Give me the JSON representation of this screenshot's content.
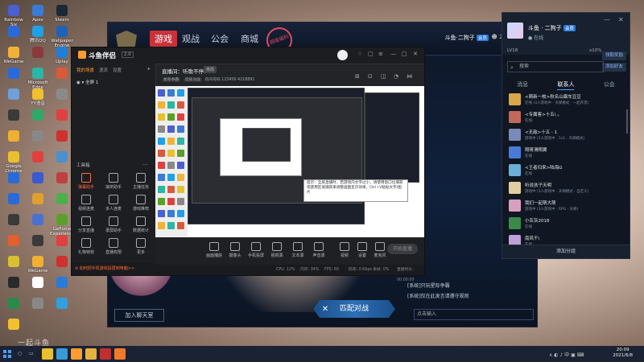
{
  "desktop_icons": [
    {
      "label": "Rainbow Six",
      "color": "#4a5fd0"
    },
    {
      "label": "Apex",
      "color": "#3a7bd5"
    },
    {
      "label": "Steam",
      "color": "#1b2838"
    },
    {
      "label": "",
      "color": "#2a6ad8"
    },
    {
      "label": "腾讯QQ",
      "color": "#1fa0e8"
    },
    {
      "label": "Wallpaper Engine",
      "color": "#1e62b8"
    },
    {
      "label": "WeGame",
      "color": "#f2b23a"
    },
    {
      "label": "",
      "color": "#8a3a3a"
    },
    {
      "label": "Uplay",
      "color": "#1e7fd8"
    },
    {
      "label": "",
      "color": "#2a6ad8"
    },
    {
      "label": "Microsoft Edge",
      "color": "#2cb6a5"
    },
    {
      "label": "",
      "color": "#d85a3a"
    },
    {
      "label": "",
      "color": "#6fa0d8"
    },
    {
      "label": "YY语音",
      "color": "#f0c030"
    },
    {
      "label": "",
      "color": "#8a8a8a"
    },
    {
      "label": "",
      "color": "#3a3a3a"
    },
    {
      "label": "",
      "color": "#2fa86a"
    },
    {
      "label": "",
      "color": "#e04040"
    },
    {
      "label": "",
      "color": "#f0b030"
    },
    {
      "label": "",
      "color": "#888888"
    },
    {
      "label": "",
      "color": "#d03030"
    },
    {
      "label": "Google Chrome",
      "color": "#e8c030"
    },
    {
      "label": "",
      "color": "#e04040"
    },
    {
      "label": "",
      "color": "#4a90d0"
    },
    {
      "label": "",
      "color": "#2a6ad8"
    },
    {
      "label": "",
      "color": "#3a5ad0"
    },
    {
      "label": "",
      "color": "#c04040"
    },
    {
      "label": "",
      "color": "#2a6ad8"
    },
    {
      "label": "",
      "color": "#e0a030"
    },
    {
      "label": "",
      "color": "#4ab04a"
    },
    {
      "label": "",
      "color": "#3a3a3a"
    },
    {
      "label": "",
      "color": "#4a70d0"
    },
    {
      "label": "GeForce Experience",
      "color": "#5aa02a"
    },
    {
      "label": "",
      "color": "#e06030"
    },
    {
      "label": "",
      "color": "#3a3a3a"
    },
    {
      "label": "",
      "color": "#e04040"
    },
    {
      "label": "",
      "color": "#d8c030"
    },
    {
      "label": "WeGame",
      "color": "#f0b030"
    },
    {
      "label": "",
      "color": "#d03030"
    },
    {
      "label": "",
      "color": "#2a2a2a"
    },
    {
      "label": "",
      "color": "#ffffff"
    },
    {
      "label": "",
      "color": "#2a7ad8"
    },
    {
      "label": "",
      "color": "#2a8a4a"
    },
    {
      "label": "",
      "color": "#888888"
    },
    {
      "label": "",
      "color": "#2fa0e0"
    },
    {
      "label": "",
      "color": "#f0c030"
    }
  ],
  "game": {
    "nav": [
      "游戏",
      "观战",
      "公会",
      "商城"
    ],
    "stamp": "超级福利",
    "username": "斗鱼·二狗子",
    "vip": "会员",
    "count": "24",
    "add_friend": "加入聊天室",
    "match_button": "匹配对战",
    "cancel_icon": "✕",
    "chat": [
      "[系统]只玩星际争霸",
      "[系统]仅在此发言请遵守规则"
    ],
    "input_placeholder": "点击输入"
  },
  "friends": {
    "name": "斗鱼 · 二狗子",
    "vip": "会员",
    "status": "在线",
    "level": "LV18",
    "level_pct": "x10%",
    "side_btn1": "领取奖励",
    "side_btn2": "添加好友",
    "search_placeholder": "搜索",
    "tabs": [
      "消息",
      "联系人",
      "公会"
    ],
    "active_tab": 1,
    "items": [
      {
        "name": "<萌新一枚>秋名山飙车豆豆",
        "status": "在线 (3人游戏中 · 天梯模式 · 一起开黑)",
        "color": "#d9a74a"
      },
      {
        "name": "<专属客>十五\\ 。",
        "status": "在线",
        "color": "#c2685a"
      },
      {
        "name": "<无敌>十五 - 1",
        "status": "游戏中 (3人游戏中 · 1v1 · 天梯模式)",
        "color": "#7a8ab8"
      },
      {
        "name": "翔哥滑翔翼",
        "status": "在线",
        "color": "#4a7ad8"
      },
      {
        "name": "<王者归来>陆海G",
        "status": "在线",
        "color": "#6ab0d8"
      },
      {
        "name": "听说孩子天明",
        "status": "游戏中 (3人游戏中 · 天梯模式 · 自定义)",
        "color": "#e0d0a0"
      },
      {
        "name": "我们一起萌大萌",
        "status": "游戏中 (3人游戏中 · RPG · 天梯)",
        "color": "#d8a0c0"
      },
      {
        "name": "小灰灰2018",
        "status": "在线",
        "color": "#3a8a4a"
      },
      {
        "name": "南风千\\",
        "status": "在线",
        "color": "#c0a0d8"
      },
      {
        "name": "<Ready to work>",
        "status": "游戏中",
        "color": "#8ab0e0"
      }
    ],
    "add_group": "添加分组"
  },
  "stream": {
    "logo": "斗鱼伴侣",
    "version": "2.0",
    "left_tabs": [
      "我的场景",
      "混流",
      "设置"
    ],
    "scene": "全屏 1",
    "tools_title": "工具箱",
    "tools": [
      {
        "label": "弹幕助手",
        "hot": true
      },
      {
        "label": "抽奖助手",
        "hot": false
      },
      {
        "label": "主播任务",
        "hot": false
      },
      {
        "label": "视频连麦",
        "hot": false
      },
      {
        "label": "多人连麦",
        "hot": false
      },
      {
        "label": "游戏推荐",
        "hot": false
      },
      {
        "label": "分享直播",
        "hot": false
      },
      {
        "label": "录屏助手",
        "hot": false
      },
      {
        "label": "数据统计",
        "hot": false
      },
      {
        "label": "礼物特效",
        "hot": false
      },
      {
        "label": "直播权限",
        "hot": false
      },
      {
        "label": "更多",
        "hot": false
      }
    ],
    "tip": "如何把手机游戏投屏到电脑>>",
    "room_title": "直播间：听歌不停！",
    "modify": "修改",
    "tags": [
      "星际争霸",
      "竞技对战"
    ],
    "room_meta": "房间号码 123456  4218891",
    "tooltip": "提示：全屏直播时，若游戏内文字过小，请使用窗口化捕获或使用区域捕获来调整画面显示效果，Ctrl+V粘贴文字/图片",
    "bottom": [
      "画面捕获",
      "摄像头",
      "手机投屏",
      "视频源",
      "文本源",
      "声音源",
      "视频",
      "设置",
      "麦克风"
    ],
    "live_button": "开始直播",
    "status": [
      "CPU: 12%",
      "内存: 34%",
      "FPS: 60",
      "码率: 0 Kbps",
      "丢帧: 0%",
      "直播时长: 00:00:00"
    ]
  },
  "taskbar": {
    "apps": [
      {
        "name": "chrome",
        "color": "#e8c030"
      },
      {
        "name": "qq",
        "color": "#3a9ad8"
      },
      {
        "name": "douyu",
        "color": "#ff9b2f"
      },
      {
        "name": "folder",
        "color": "#e8b040"
      },
      {
        "name": "game",
        "color": "#c03030"
      },
      {
        "name": "stream",
        "color": "#f07a2a"
      }
    ],
    "time": "20:09",
    "date": "2021/6/8",
    "tray": "∧ ◐ ♪ 中 ▣ ⌨"
  },
  "watermark": "一起斗鱼",
  "colors": {
    "accent": "#ff9b2f",
    "game_red": "#c8323a",
    "blue": "#4aa0ff"
  }
}
